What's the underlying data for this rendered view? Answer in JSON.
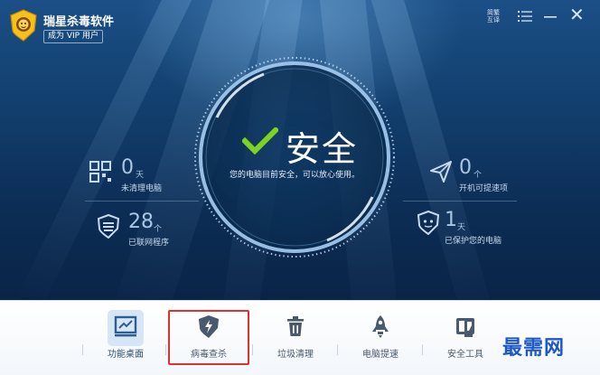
{
  "window": {
    "app_title": "瑞星杀毒软件",
    "vip_link": "成为 VIP 用户",
    "lang_label_line1": "简繁",
    "lang_label_line2": "互译",
    "close_glyph": "✕"
  },
  "status": {
    "title": "安全",
    "description": "您的电脑目前安全，可以放心使用。",
    "color": "#7ed321"
  },
  "stats": {
    "left_top": {
      "icon": "apps-grid-icon",
      "value": "0",
      "unit": "天",
      "label": "未清理电脑"
    },
    "left_bottom": {
      "icon": "firewall-icon",
      "value": "28",
      "unit": "个",
      "label": "已联网程序"
    },
    "right_top": {
      "icon": "speedup-icon",
      "value": "0",
      "unit": "个",
      "label": "开机可提速项"
    },
    "right_bottom": {
      "icon": "shield-protect-icon",
      "value": "1",
      "unit": "天",
      "label": "已保护您的电脑"
    }
  },
  "toolbar": {
    "items": [
      {
        "icon": "desktop-chart-icon",
        "label": "功能桌面",
        "active": true
      },
      {
        "icon": "virus-shield-icon",
        "label": "病毒查杀",
        "active": false
      },
      {
        "icon": "trash-icon",
        "label": "垃圾清理",
        "active": false
      },
      {
        "icon": "rocket-icon",
        "label": "电脑提速",
        "active": false
      },
      {
        "icon": "toolbox-icon",
        "label": "安全工具",
        "active": false
      }
    ]
  },
  "watermark": "最需网",
  "colors": {
    "hero_dark": "#0a2446",
    "highlight": "#e2302c",
    "accent": "#2b6db0"
  }
}
